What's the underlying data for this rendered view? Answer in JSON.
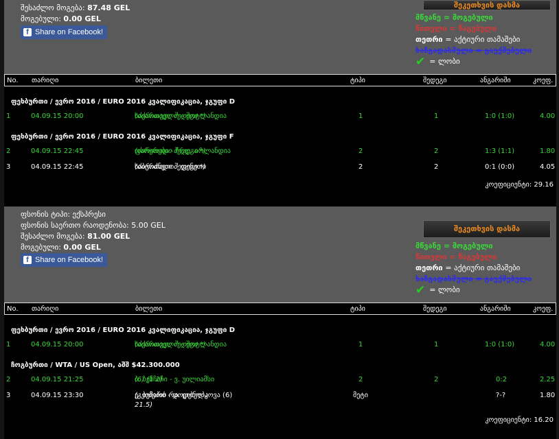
{
  "ticket1": {
    "info": [
      {
        "label": "შესაძლო მოგება:",
        "value": "87.48 GEL"
      },
      {
        "label": "მოგებული:",
        "value": "0.00 GEL"
      }
    ],
    "share_label": "Share on Facebook!",
    "legend": {
      "win": "მწვანე = მოგებული",
      "lose": "წითელი = წაგებული",
      "void_key": "თეთრი",
      "void_text": "= აქტიური თამაშები",
      "cancel": "ხაზგადასმული = გაუქმებული",
      "bonus": "= ლობი"
    },
    "header": {
      "no": "No.",
      "date": "თარიღი",
      "ticket": "ბილეთი",
      "type": "ტიპი",
      "outcome": "შედეგი",
      "score": "ანგარიში",
      "coef": "კოეფ."
    },
    "groups": [
      {
        "title": "ფეხბურთი / ევრო 2016 / EURO 2016 კვალიფიკაცია, ჯგუფი D"
      },
      {
        "title": "ფეხბურთი / ევრო 2016 / EURO 2016 კვალიფიკაცია, ჯგუფი F"
      }
    ],
    "rows": [
      {
        "no": "1",
        "date": "04.09.15 20:00",
        "match": "საქართველო - შოტლანდია",
        "note": "(ძირითადი შედეგი *)",
        "type": "1",
        "outcome": "1",
        "score": "1:0 (1:0)",
        "coef": "4.00"
      },
      {
        "no": "2",
        "date": "04.09.15 22:45",
        "match": "ფარერები - ჩრდ. ირლანდია",
        "note": "(ძირითადი შედეგი *)",
        "type": "2",
        "outcome": "2",
        "score": "1:3 (1:1)",
        "coef": "1.80"
      },
      {
        "no": "3",
        "date": "04.09.15 22:45",
        "match": "საბერძნეთი - ფინეთი",
        "note": "(ძირითადი შედეგი *)",
        "type": "2",
        "outcome": "2",
        "score": "0:1 (0:0)",
        "coef": "4.05"
      }
    ],
    "total": "კოეფიციენტი: 29.16"
  },
  "ticket2": {
    "info": [
      {
        "label": "ფსონის ტიპი:",
        "value": "ექსპრესი"
      },
      {
        "label": "ფსონის საერთო რაოდენობა:",
        "value": "5.00 GEL"
      },
      {
        "label": "შესაძლო მოგება:",
        "value": "81.00 GEL"
      },
      {
        "label": "მოგებული:",
        "value": "0.00 GEL"
      }
    ],
    "share_label": "Share on Facebook!",
    "place_bet_label": "შეკეთხვის დასმა",
    "legend": {
      "win": "მწვანე = მოგებული",
      "lose": "წითელი = წაგებული",
      "void_key": "თეთრი",
      "void_text": "= აქტიური თამაშები",
      "cancel": "ხაზგადასმული = გაუქმებული",
      "bonus": "= ლობი"
    },
    "header": {
      "no": "No.",
      "date": "თარიღი",
      "ticket": "ბილეთი",
      "type": "ტიპი",
      "outcome": "შედეგი",
      "score": "ანგარიში",
      "coef": "კოეფ."
    },
    "groups": [
      {
        "title": "ფეხბურთი / ევრო 2016 / EURO 2016 კვალიფიკაცია, ჯგუფი D"
      },
      {
        "title": "ჩოგბურთი / WTA / US Open, აშშ $42.300.000"
      }
    ],
    "rows": [
      {
        "no": "1",
        "date": "04.09.15 20:00",
        "match": "საქართველო - შოტლანდია",
        "note": "(ძირითადი შედეგი *)",
        "type": "1",
        "outcome": "1",
        "score": "1:0 (1:0)",
        "coef": "4.00"
      },
      {
        "no": "2",
        "date": "04.09.15 21:25",
        "match": "ბ. ბენჩიჩი - ვ. უილიამსი",
        "note": "(6) (1 2)",
        "type": "2",
        "outcome": "2",
        "score": "0:2",
        "coef": "2.25"
      },
      {
        "no": "3",
        "date": "04.09.15 23:30",
        "match": "ე. ბუჩარი - დ. ციბულკოვა (6)",
        "note": "(გეიმების რაოდენობა",
        "note2": "21.5)",
        "type": "მეტი",
        "outcome": "",
        "score": "?-?",
        "coef": "1.80"
      }
    ],
    "total": "კოეფიციენტი: 16.20"
  }
}
